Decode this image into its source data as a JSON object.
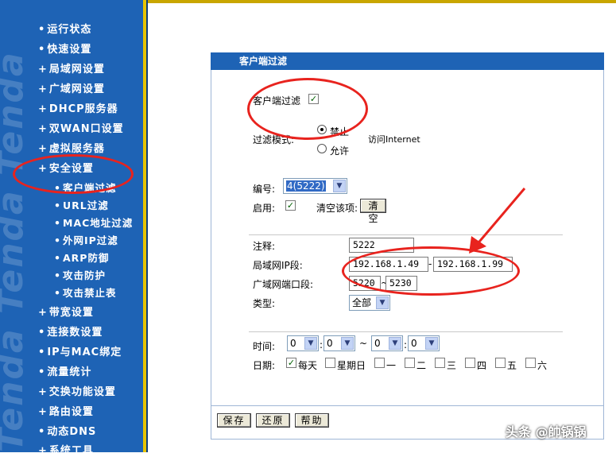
{
  "sidebar": {
    "watermark": "Tenda Tenda Tenda",
    "items": [
      {
        "bullet": "•",
        "label": "运行状态"
      },
      {
        "bullet": "•",
        "label": "快速设置"
      },
      {
        "bullet": "+",
        "label": "局域网设置"
      },
      {
        "bullet": "+",
        "label": "广域网设置"
      },
      {
        "bullet": "+",
        "label": "DHCP服务器"
      },
      {
        "bullet": "+",
        "label": "双WAN口设置"
      },
      {
        "bullet": "+",
        "label": "虚拟服务器"
      },
      {
        "bullet": "+",
        "label": "安全设置"
      },
      {
        "bullet": "•",
        "label": "客户端过滤"
      },
      {
        "bullet": "•",
        "label": "URL过滤"
      },
      {
        "bullet": "•",
        "label": "MAC地址过滤"
      },
      {
        "bullet": "•",
        "label": "外网IP过滤"
      },
      {
        "bullet": "•",
        "label": "ARP防御"
      },
      {
        "bullet": "•",
        "label": "攻击防护"
      },
      {
        "bullet": "•",
        "label": "攻击禁止表"
      },
      {
        "bullet": "+",
        "label": "带宽设置"
      },
      {
        "bullet": "•",
        "label": "连接数设置"
      },
      {
        "bullet": "•",
        "label": "IP与MAC绑定"
      },
      {
        "bullet": "•",
        "label": "流量统计"
      },
      {
        "bullet": "+",
        "label": "交换功能设置"
      },
      {
        "bullet": "+",
        "label": "路由设置"
      },
      {
        "bullet": "•",
        "label": "动态DNS"
      },
      {
        "bullet": "+",
        "label": "系统工具"
      }
    ]
  },
  "panel": {
    "title": "客户端过滤",
    "client_filter_label": "客户端过滤",
    "client_filter_checked": "✓",
    "filter_mode_label": "过滤模式:",
    "mode_forbid": "禁止",
    "mode_allow": "允许",
    "access_internet": "访问Internet",
    "number_label": "编号:",
    "number_value": "4(5222)",
    "enable_label": "启用:",
    "enable_checked": "✓",
    "clear_label": "清空该项:",
    "clear_button": "清空",
    "note_label": "注释:",
    "note_value": "5222",
    "lan_ip_label": "局域网IP段:",
    "lan_ip_start": "192.168.1.49",
    "ip_sep": "-",
    "lan_ip_end": "192.168.1.99",
    "wan_port_label": "广域网端口段:",
    "wan_port_start": "5220",
    "port_sep": "~",
    "wan_port_end": "5230",
    "type_label": "类型:",
    "type_value": "全部",
    "time_label": "时间:",
    "time_h1": "0",
    "time_colon1": ":",
    "time_m1": "0",
    "time_tilde": "~",
    "time_h2": "0",
    "time_colon2": ":",
    "time_m2": "0",
    "date_label": "日期:",
    "days": [
      {
        "label": "每天",
        "checked": "✓"
      },
      {
        "label": "星期日",
        "checked": ""
      },
      {
        "label": "一",
        "checked": ""
      },
      {
        "label": "二",
        "checked": ""
      },
      {
        "label": "三",
        "checked": ""
      },
      {
        "label": "四",
        "checked": ""
      },
      {
        "label": "五",
        "checked": ""
      },
      {
        "label": "六",
        "checked": ""
      }
    ],
    "save_button": "保存",
    "restore_button": "还原",
    "help_button": "帮助"
  },
  "watermark": "头条 @帥锅锅",
  "colors": {
    "sidebar": "#1e63b5",
    "header": "#1e63b5",
    "annotation": "#e8231e"
  }
}
